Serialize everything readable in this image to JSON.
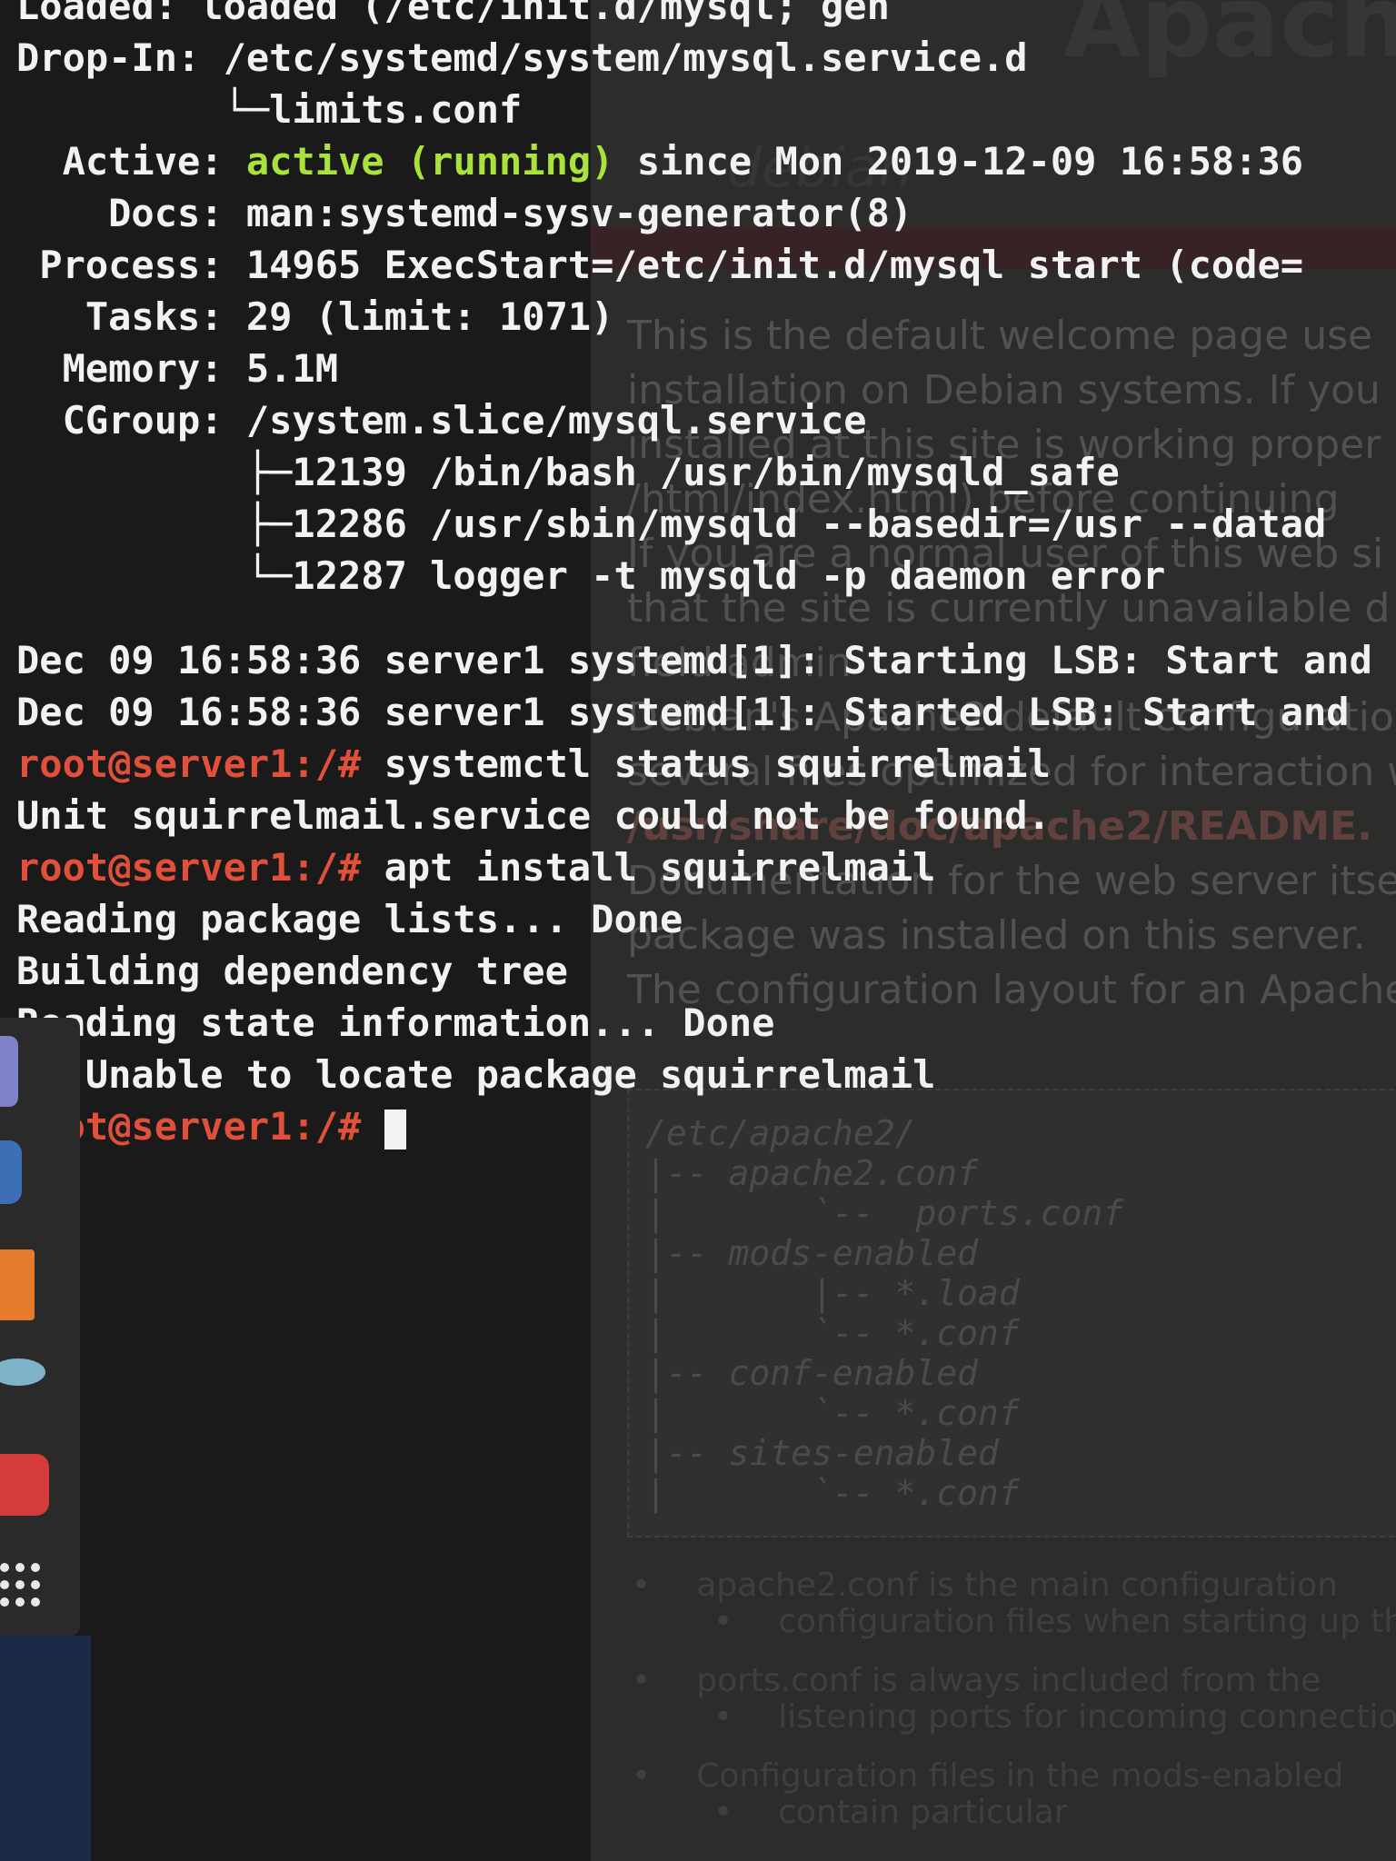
{
  "background_page": {
    "header": "Apache",
    "logo": "debian",
    "intro_lines": [
      "This is the default welcome page use",
      "installation on Debian systems. If you",
      "installed at this site is working proper",
      "/html/index.html) before continuing",
      "If you are a normal user of this web si",
      "that the site is currently unavailable d",
      "field admin"
    ],
    "config_lines_pre": "Debian's Apache2 default configuration",
    "config_lines_2": "several files optimized for interaction w",
    "readme_path": "/usr/share/doc/apache2/README.",
    "doc_line_1": "Documentation for the web server itself",
    "doc_line_2": "package was installed on this server.",
    "layout_line": "The configuration layout for an Apache2",
    "config_tree": "/etc/apache2/\n|-- apache2.conf\n|       `--  ports.conf\n|-- mods-enabled\n|       |-- *.load\n|       `-- *.conf\n|-- conf-enabled\n|       `-- *.conf\n|-- sites-enabled\n|       `-- *.conf",
    "bullets": [
      "apache2.conf is the main configuration",
      "configuration files when starting up the",
      "ports.conf is always included from the",
      "listening ports for incoming connections",
      "Configuration files in the mods-enabled",
      "contain particular"
    ]
  },
  "terminal": {
    "line_loaded": "Loaded: loaded (/etc/init.d/mysql; gen",
    "line_dropin": "Drop-In: /etc/systemd/system/mysql.service.d",
    "line_limits": "         └─limits.conf",
    "active_label": "  Active: ",
    "active_status": "active (running)",
    "active_since": " since Mon 2019-12-09 16:58:36",
    "line_docs": "    Docs: man:systemd-sysv-generator(8)",
    "line_process": " Process: 14965 ExecStart=/etc/init.d/mysql start (code=",
    "line_tasks": "   Tasks: 29 (limit: 1071)",
    "line_memory": "  Memory: 5.1M",
    "line_cgroup": "  CGroup: /system.slice/mysql.service",
    "line_cg1": "          ├─12139 /bin/bash /usr/bin/mysqld_safe",
    "line_cg2": "          ├─12286 /usr/sbin/mysqld --basedir=/usr --datad",
    "line_cg3": "          └─12287 logger -t mysqld -p daemon error",
    "line_log1": "Dec 09 16:58:36 server1 systemd[1]: Starting LSB: Start and",
    "line_log2": "Dec 09 16:58:36 server1 systemd[1]: Started LSB: Start and",
    "prompt": "root@server1:/#",
    "cmd1": " systemctl status squirrelmail",
    "line_notfound": "Unit squirrelmail.service could not be found.",
    "cmd2": " apt install squirrelmail",
    "line_reading": "Reading package lists... Done",
    "line_building": "Building dependency tree",
    "line_state": "Reading state information... Done",
    "line_error": "E: Unable to locate package squirrelmail"
  },
  "dock": {
    "icons": [
      "app-icon",
      "files-icon",
      "software-center-icon",
      "remmina-icon",
      "screenshot-icon",
      "show-applications-icon"
    ]
  }
}
